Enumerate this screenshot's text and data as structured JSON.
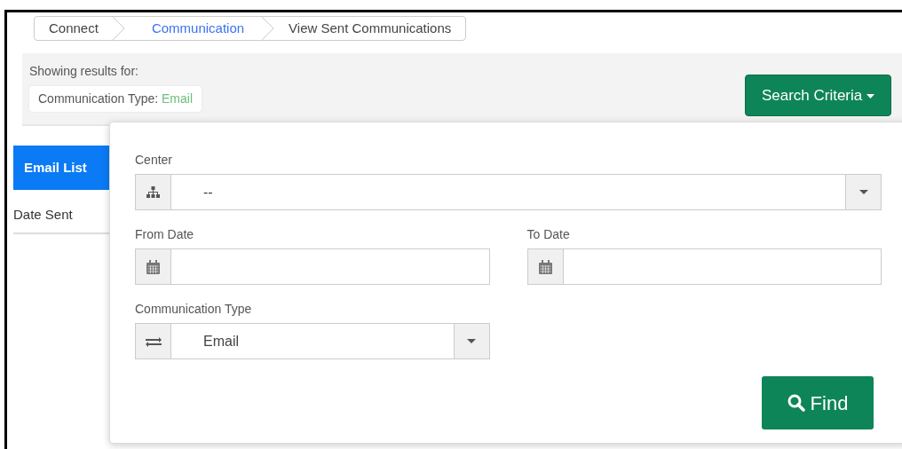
{
  "breadcrumb": [
    {
      "label": "Connect",
      "kind": "plain"
    },
    {
      "label": "Communication",
      "kind": "link"
    },
    {
      "label": "View Sent Communications",
      "kind": "plain"
    }
  ],
  "filters": {
    "heading": "Showing results for:",
    "chips": [
      {
        "label": "Communication Type:",
        "value": "Email"
      }
    ]
  },
  "search_criteria_button": "Search Criteria",
  "tabs": [
    {
      "label": "Email List",
      "selected": true
    }
  ],
  "table": {
    "columns": [
      "Date Sent"
    ]
  },
  "search_panel": {
    "fields": [
      {
        "label": "Center",
        "kind": "org-select",
        "value": "--"
      },
      {
        "label": "From Date",
        "kind": "date"
      },
      {
        "label": "To Date",
        "kind": "date"
      },
      {
        "label": "Communication Type",
        "kind": "type-select",
        "value": "Email"
      }
    ],
    "find_button": "Find"
  }
}
